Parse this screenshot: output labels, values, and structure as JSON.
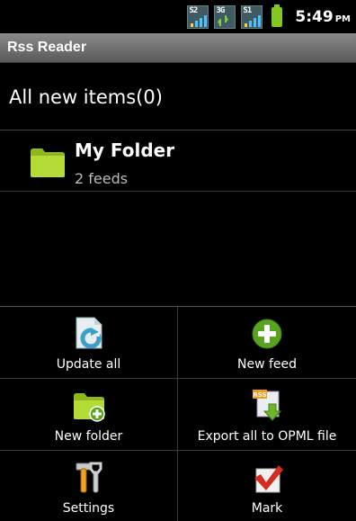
{
  "status_bar": {
    "signals": [
      "S2",
      "3G",
      "S1"
    ],
    "time": "5:49",
    "ampm": "PM"
  },
  "app": {
    "title": "Rss Reader"
  },
  "all_new_items": "All new items(0)",
  "folders": [
    {
      "name": "My Folder",
      "feeds": "2 feeds"
    }
  ],
  "menu": {
    "update_all": "Update all",
    "new_feed": "New feed",
    "new_folder": "New folder",
    "export_opml": "Export all to OPML file",
    "settings": "Settings",
    "mark": "Mark"
  },
  "colors": {
    "folder_green": "#a7d12d",
    "plus_green": "#58a420",
    "mark_red": "#d62b1f"
  }
}
